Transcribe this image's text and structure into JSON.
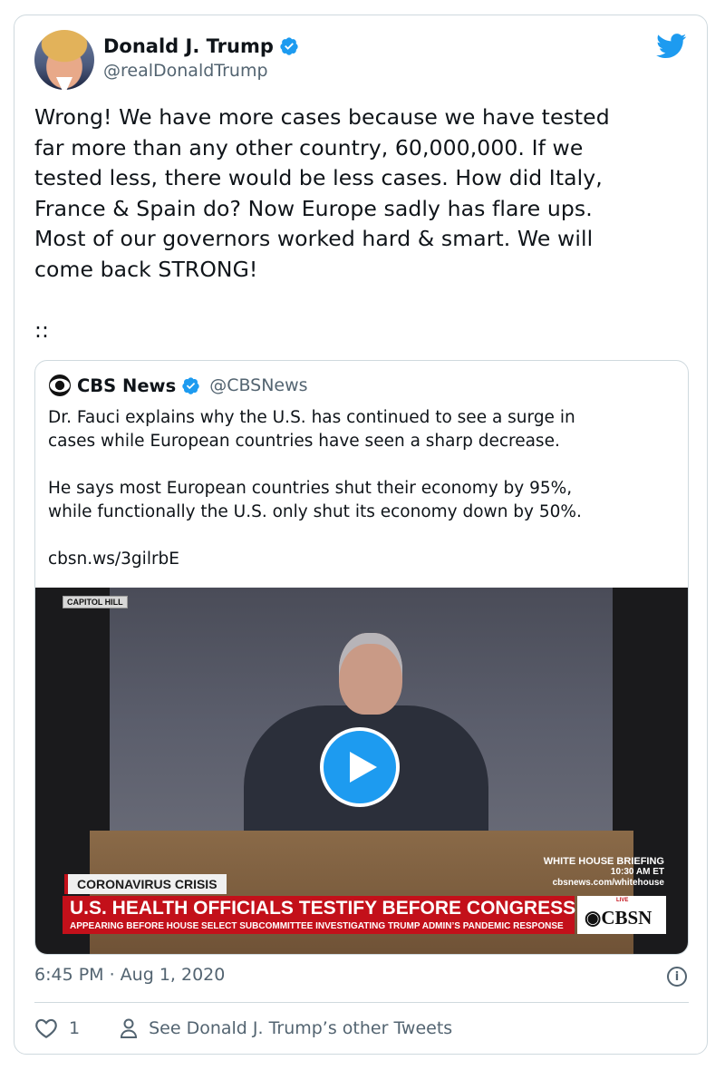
{
  "author": {
    "name": "Donald J. Trump",
    "handle": "@realDonaldTrump",
    "verified": true
  },
  "tweet": {
    "text": "Wrong! We have more cases because we have tested\nfar more than any other country, 60,000,000. If we\ntested less, there would be less cases. How did Italy,\nFrance & Spain do? Now Europe sadly has flare ups.\nMost of our governors worked hard & smart. We will\ncome back STRONG!\n\n::",
    "timestamp": "6:45 PM · Aug 1, 2020",
    "like_count": "1",
    "other_tweets_label": "See Donald J. Trump’s other Tweets"
  },
  "quoted": {
    "name": "CBS News",
    "handle": "@CBSNews",
    "verified": true,
    "text": "Dr. Fauci explains why the U.S. has continued to see a surge in\ncases while European countries have seen a sharp decrease.\n\nHe says most European countries shut their economy by 95%,\nwhile functionally the U.S. only shut its economy down by 50%.\n\ncbsn.ws/3gilrbE",
    "video": {
      "location_tag": "CAPITOL HILL",
      "briefing_title": "WHITE HOUSE BRIEFING",
      "briefing_time": "10:30 AM ET",
      "briefing_url": "cbsnews.com/whitehouse",
      "crisis_label": "CORONAVIRUS CRISIS",
      "headline": "U.S. HEALTH OFFICIALS TESTIFY BEFORE CONGRESS",
      "subheadline": "APPEARING BEFORE HOUSE SELECT SUBCOMMITTEE INVESTIGATING TRUMP ADMIN’S PANDEMIC RESPONSE",
      "live_label": "LIVE",
      "network_logo": "CBSN"
    }
  },
  "icons": {
    "brand": "twitter-bird-icon",
    "verified": "verified-badge-icon",
    "like": "heart-icon",
    "profile": "person-icon",
    "info": "info-icon",
    "play": "play-icon"
  },
  "colors": {
    "accent": "#1d9bf0",
    "text": "#0f1419",
    "secondary": "#536471",
    "border": "#cfd9de",
    "news_red": "#c3101a"
  }
}
